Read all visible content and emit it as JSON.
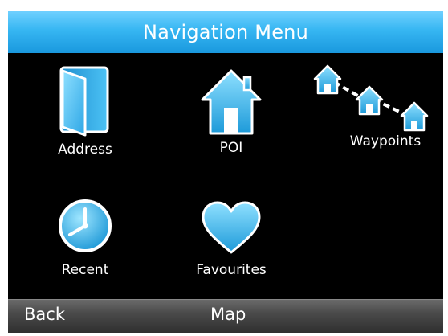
{
  "header": {
    "title": "Navigation Menu"
  },
  "menu": {
    "items": [
      {
        "label": "Address",
        "icon": "book-icon"
      },
      {
        "label": "POI",
        "icon": "house-icon"
      },
      {
        "label": "Waypoints",
        "icon": "waypoints-icon"
      },
      {
        "label": "Recent",
        "icon": "clock-icon"
      },
      {
        "label": "Favourites",
        "icon": "heart-icon"
      }
    ]
  },
  "softkeys": {
    "left": "Back",
    "center": "Map"
  },
  "colors": {
    "accent": "#2aaae8",
    "background": "#000000",
    "text": "#ffffff"
  }
}
